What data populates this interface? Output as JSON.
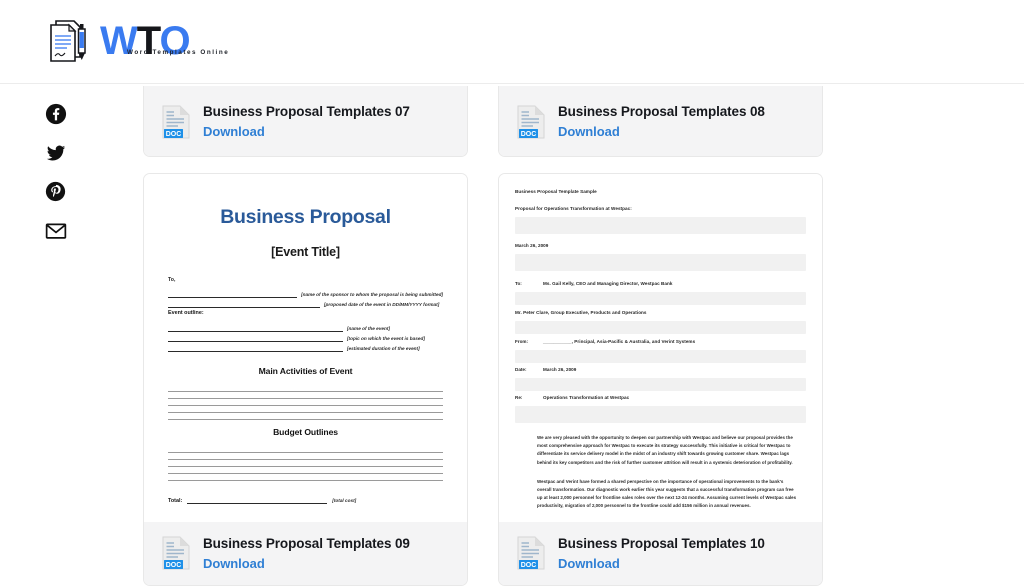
{
  "site": {
    "logo_word_1": "W",
    "logo_word_2": "T",
    "logo_word_3": "O",
    "logo_tagline": "Word Templates Online",
    "logo_icon": "document-pen-icon"
  },
  "social": {
    "items": [
      {
        "name": "facebook-icon",
        "label": "Facebook"
      },
      {
        "name": "twitter-icon",
        "label": "Twitter"
      },
      {
        "name": "pinterest-icon",
        "label": "Pinterest"
      },
      {
        "name": "email-icon",
        "label": "Email"
      }
    ]
  },
  "colors": {
    "accent_blue": "#3a7bf0",
    "link_blue": "#2f7fd4",
    "doc_badge_blue": "#1e90e8",
    "card_footer_bg": "#f4f4f5",
    "heading_navy": "#2a5a99"
  },
  "cards": [
    {
      "title": "Business Proposal Templates 07",
      "download_label": "Download",
      "file_type": "DOC"
    },
    {
      "title": "Business Proposal Templates 08",
      "download_label": "Download",
      "file_type": "DOC"
    },
    {
      "title": "Business Proposal Templates 09",
      "download_label": "Download",
      "file_type": "DOC"
    },
    {
      "title": "Business Proposal Templates 10",
      "download_label": "Download",
      "file_type": "DOC"
    }
  ],
  "preview_left": {
    "title": "Business Proposal",
    "subtitle": "[Event Title]",
    "to_label": "To,",
    "note_sponsor": "[name of the sponsor to whom the proposal is being submitted]",
    "note_date": "[proposed date of the event in DD/MM/YYYY format]",
    "event_outline_label": "Event outline:",
    "note_event_name": "[name of the event]",
    "note_event_topic": "[topic on which the event is based]",
    "note_event_duration": "[estimated duration of the event]",
    "heading_activities": "Main Activities of Event",
    "heading_budget": "Budget Outlines",
    "total_label": "Total:",
    "note_total": "[total cost]"
  },
  "preview_right": {
    "header": "Business Proposal Template Sample",
    "subject_line": "Proposal for Operations Transformation at Westpac:",
    "date_top": "March 26, 2009",
    "to_key": "To:",
    "to_value": "Ms. Gail Kelly, CEO and Managing Director, Westpac Bank",
    "to_value_2": "Mr. Peter Clare, Group Executive, Products and Operations",
    "from_key": "From:",
    "from_value": "___________, Principal, Asia-Pacific & Australia, and Verint Systems",
    "date_key": "Date:",
    "date_value": "March 26, 2009",
    "re_key": "Re:",
    "re_value": "Operations Transformation at Westpac",
    "paragraph_1": "We are very pleased with the opportunity to deepen our partnership with Westpac and believe our proposal provides the most comprehensive approach for Westpac to execute its strategy successfully.  This initiative is critical for Westpac to differentiate its service delivery model in the midst of an industry shift towards growing customer share.  Westpac lags behind its key competitors and the risk of further customer attrition will result in a systemic deterioration of profitability.",
    "paragraph_2": "Westpac and Verint have formed a shared perspective on the importance of operational improvements to the bank's overall transformation.  Our diagnostic work earlier this year suggests that a successful transformation program can free up at least 2,000 personnel for frontline sales roles over the next 12-24 months.  Assuming current levels of Westpac sales productivity, migration of 2,000 personnel to the frontline could add $156 million in annual revenues."
  }
}
